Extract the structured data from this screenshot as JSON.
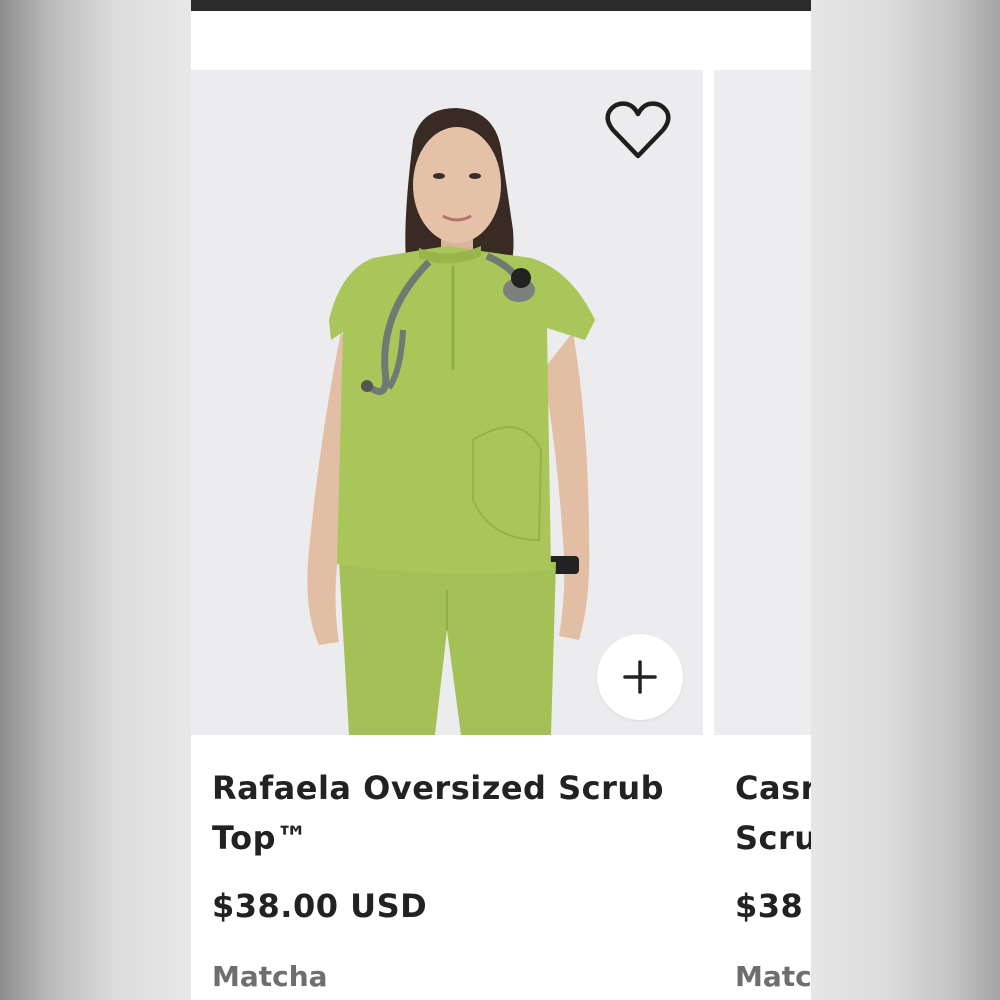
{
  "products": [
    {
      "title": "Rafaela Oversized Scrub Top™",
      "price": "$38.00 USD",
      "color": "Matcha",
      "favorite_icon": "heart-icon",
      "add_icon": "plus-icon"
    },
    {
      "title": "Casr\nScru",
      "price": "$38",
      "color": "Matc"
    }
  ],
  "colors": {
    "scrub_green": "#a8c65a",
    "image_bg": "#ececee",
    "text": "#222222",
    "muted_text": "#6e6e6e"
  }
}
